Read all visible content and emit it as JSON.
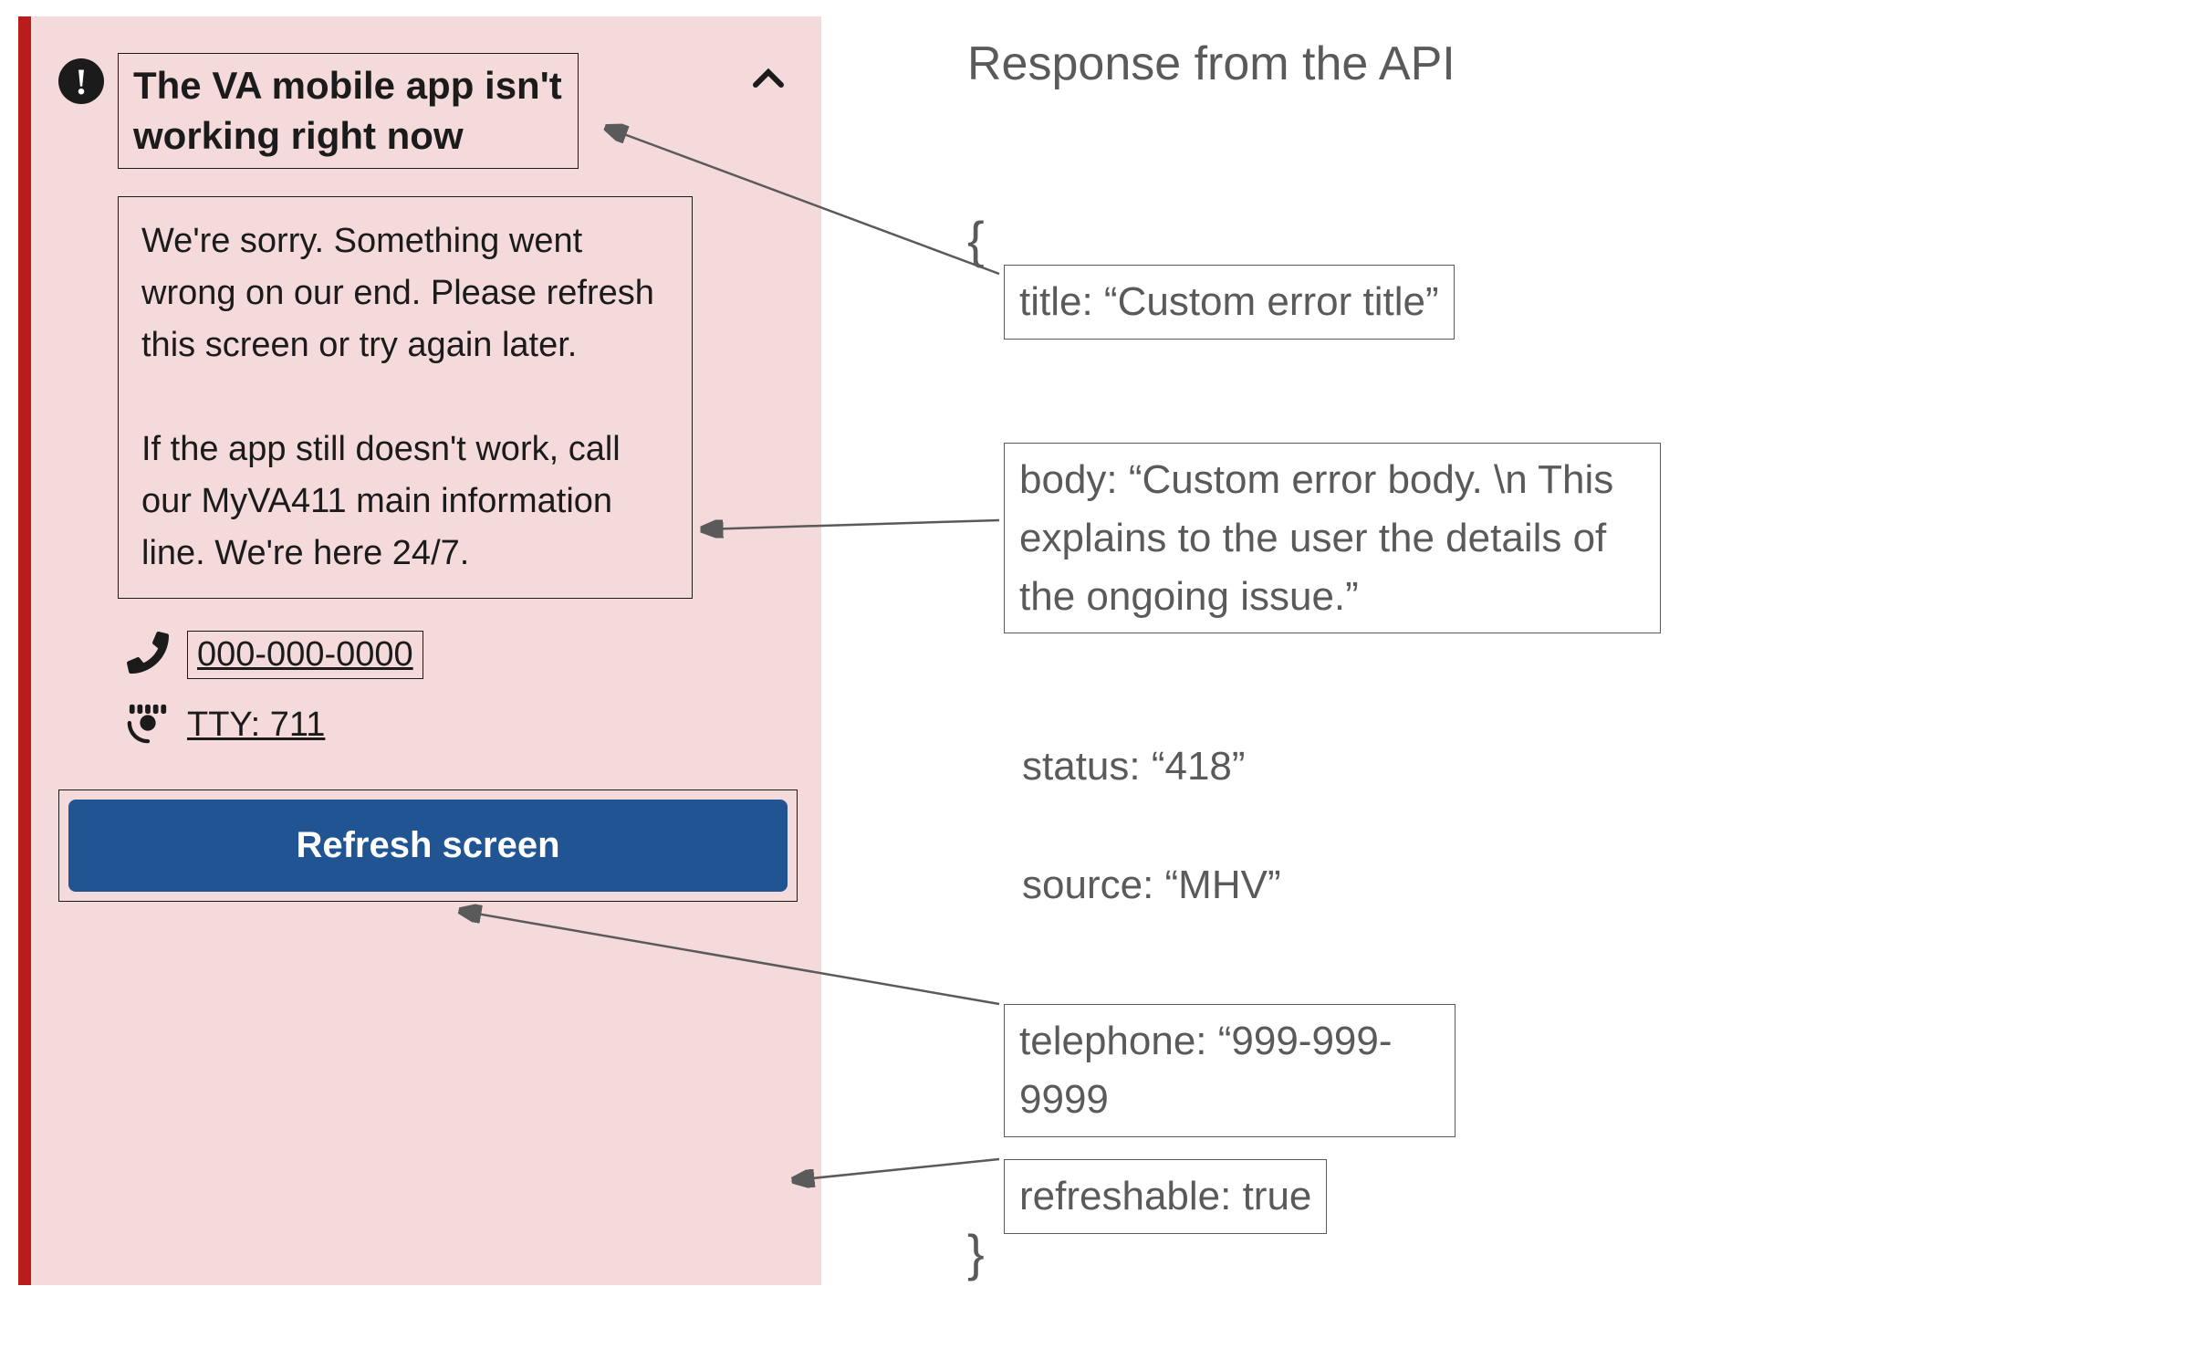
{
  "alert": {
    "title": "The VA mobile app isn't working right now",
    "body": "We're sorry. Something went wrong on our end. Please refresh this screen or try again later.\n\nIf the app still doesn't work, call our MyVA411 main information line. We're here 24/7.",
    "phone": "000-000-0000",
    "tty": "TTY: 711",
    "refresh_button": "Refresh screen"
  },
  "api": {
    "heading": "Response from the API",
    "brace_open": "{",
    "brace_close": "}",
    "title_field": "title: “Custom error title”",
    "body_field": "body: “Custom error body. \\n This explains to the user the details of the ongoing issue.”",
    "status_field": "status: “418”",
    "source_field": "source: “MHV”",
    "telephone_field": "telephone: “999-999-9999",
    "refreshable_field": "refreshable: true"
  }
}
